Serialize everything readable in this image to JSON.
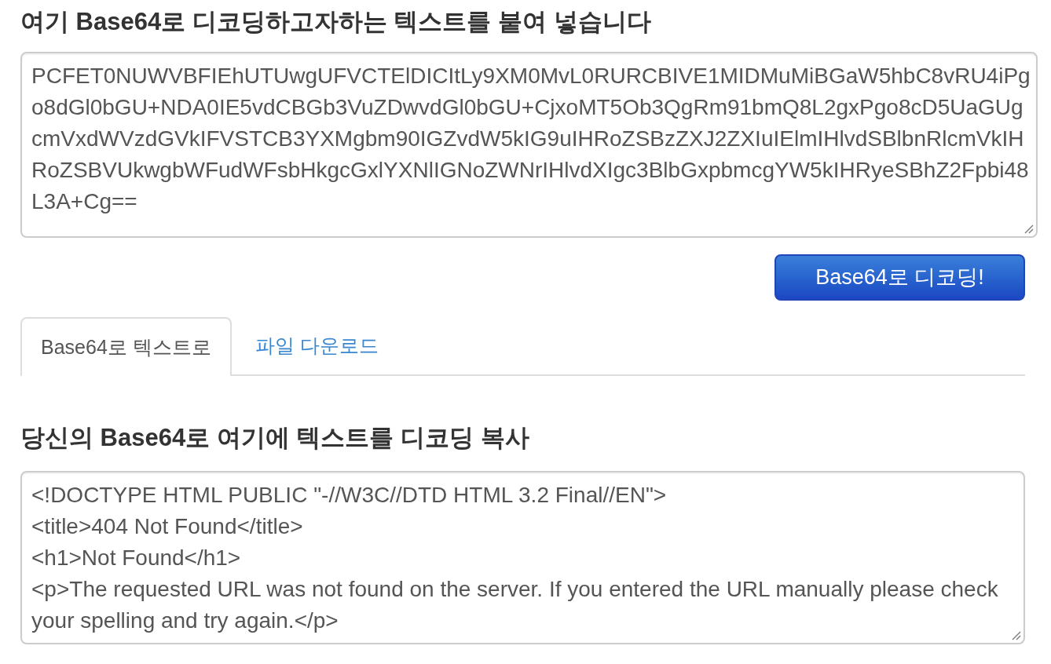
{
  "input_section": {
    "heading": "여기 Base64로 디코딩하고자하는 텍스트를 붙여 넣습니다",
    "input": {
      "value": "PCFET0NUWVBFIEhUTUwgUFVCTElDICItLy9XM0MvL0RURCBIVE1MIDMuMiBGaW5hbC8vRU4iPgo8dGl0bGU+NDA0IE5vdCBGb3VuZDwvdGl0bGU+CjxoMT5Ob3QgRm91bmQ8L2gxPgo8cD5UaGUgcmVxdWVzdGVkIFVSTCB3YXMgbm90IGZvdW5kIG9uIHRoZSBzZXJ2ZXIuIElmIHlvdSBlbnRlcmVkIHRoZSBVUkwgbWFudWFsbHkgcGxlYXNlIGNoZWNrIHlvdXIgc3BlbGxpbmcgYW5kIHRyeSBhZ2Fpbi48L3A+Cg=="
    }
  },
  "decode_button": {
    "label": "Base64로 디코딩!"
  },
  "tabs": [
    {
      "label": "Base64로 텍스트로",
      "selected": true
    },
    {
      "label": "파일 다운로드",
      "selected": false
    }
  ],
  "output_section": {
    "heading": "당신의 Base64로 여기에 텍스트를 디코딩 복사",
    "output": {
      "value": "<!DOCTYPE HTML PUBLIC \"-//W3C//DTD HTML 3.2 Final//EN\">\n<title>404 Not Found</title>\n<h1>Not Found</h1>\n<p>The requested URL was not found on the server. If you entered the URL manually please check your spelling and try again.</p>"
    }
  }
}
